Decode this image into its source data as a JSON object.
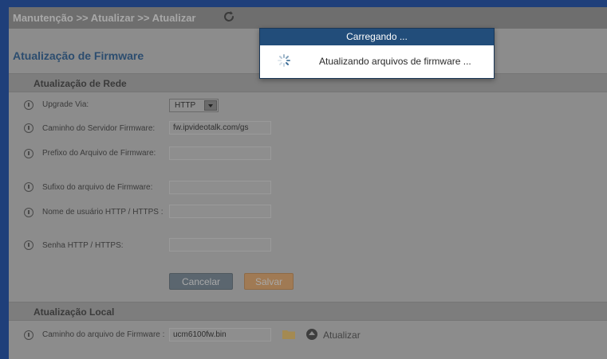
{
  "breadcrumb": "Manutenção >> Atualizar >> Atualizar",
  "page_title": "Atualização de Firmware",
  "network_section": {
    "title": "Atualização de Rede",
    "upgrade_via": {
      "label": "Upgrade Via:",
      "value": "HTTP"
    },
    "server_path": {
      "label": "Caminho do Servidor Firmware:",
      "value": "fw.ipvideotalk.com/gs"
    },
    "file_prefix": {
      "label": "Prefixo do Arquivo de Firmware:",
      "value": ""
    },
    "file_suffix": {
      "label": "Sufixo do arquivo de Firmware:",
      "value": ""
    },
    "http_username": {
      "label": "Nome de usuário HTTP / HTTPS :",
      "value": ""
    },
    "http_password": {
      "label": "Senha HTTP / HTTPS:",
      "value": ""
    },
    "cancel_label": "Cancelar",
    "save_label": "Salvar"
  },
  "local_section": {
    "title": "Atualização Local",
    "file_path": {
      "label": "Caminho do arquivo de Firmware :",
      "value": "ucm6100fw.bin"
    },
    "upload_label": "Atualizar"
  },
  "dialog": {
    "title": "Carregando ...",
    "message": "Atualizando arquivos de firmware ..."
  },
  "colors": {
    "dialog_header": "#224d7a",
    "save_button": "#a07a54",
    "cancel_button": "#5b666f",
    "title_text": "#2c4d6f"
  },
  "icons": [
    "refresh-icon",
    "info-icon",
    "dropdown-arrow-icon",
    "folder-icon",
    "upload-icon",
    "spinner-icon"
  ]
}
